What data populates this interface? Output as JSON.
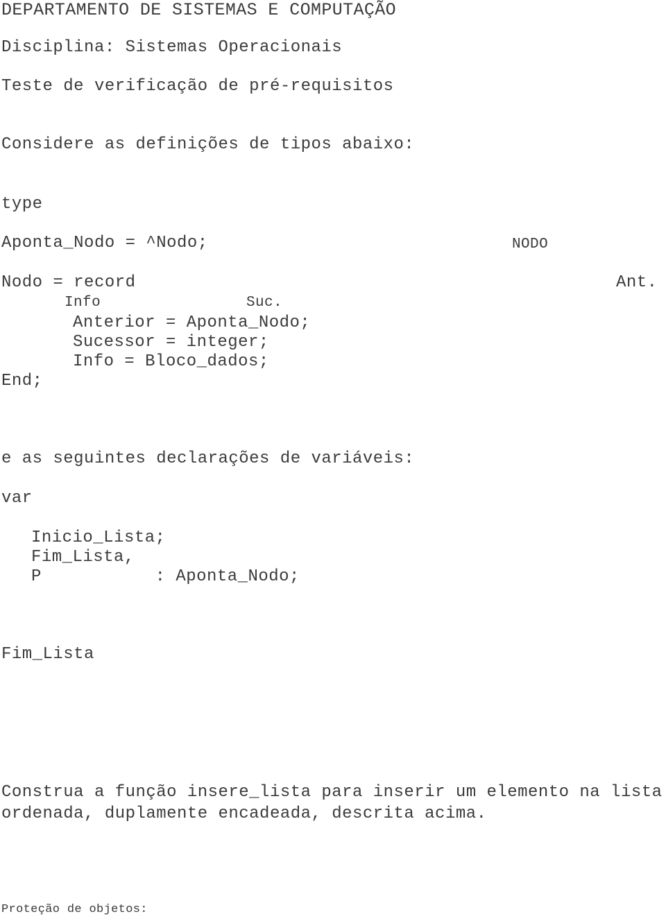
{
  "document": {
    "department": "DEPARTAMENTO DE SISTEMAS E COMPUTAÇÃO",
    "course_line": "Disciplina: Sistemas Operacionais",
    "exam_title": "Teste de verificação de pré-requisitos"
  },
  "intro": {
    "prompt": "Considere as definições de tipos abaixo:"
  },
  "type_definitions": {
    "keyword": "type",
    "lines": [
      "Aponta_Nodo = ^Nodo;",
      "Nodo = record",
      "Anterior = Aponta_Nodo;",
      "Sucessor = integer;",
      "Info = Bloco_dados;",
      "End;"
    ],
    "diagram_labels": {
      "node": "NODO",
      "info": "Info",
      "suc": "Suc.",
      "ant": "Ant."
    }
  },
  "var_section": {
    "prompt": "e as seguintes declarações de variáveis:",
    "keyword": "var",
    "lines": [
      "Inicio_Lista;",
      "Fim_Lista,",
      "P           : Aponta_Nodo;"
    ]
  },
  "list_diagram": {
    "end_label": "Fim_Lista"
  },
  "task": {
    "line1": "Construa a função insere_lista para inserir um elemento na lista",
    "line2": "ordenada, duplamente encadeada, descrita acima."
  },
  "footer": {
    "section_label": "Proteção de objetos:"
  },
  "style": {
    "text_color": "#3b3b3b",
    "background": "#ffffff"
  }
}
